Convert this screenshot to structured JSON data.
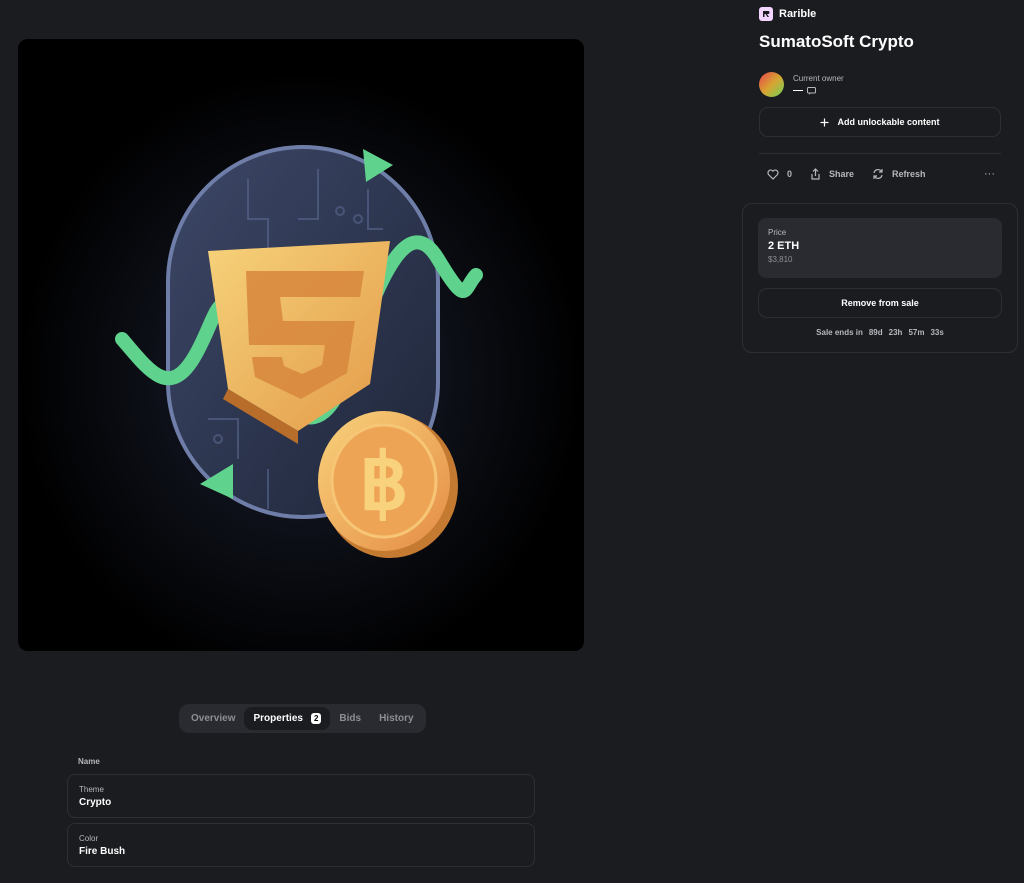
{
  "brand": {
    "name": "Rarible",
    "logo_icon": "rarible-logo-icon"
  },
  "item": {
    "title": "SumatoSoft Crypto"
  },
  "owner": {
    "label": "Current owner",
    "name": "—"
  },
  "unlockable": {
    "label": "Add unlockable content",
    "icon": "plus-icon"
  },
  "actions": {
    "likes": "0",
    "share_label": "Share",
    "refresh_label": "Refresh",
    "more_label": "···"
  },
  "sale": {
    "price_label": "Price",
    "price_value": "2 ETH",
    "price_fiat": "$3,810",
    "remove_label": "Remove from sale",
    "ends_label": "Sale ends in",
    "days": "89d",
    "hours": "23h",
    "minutes": "57m",
    "seconds": "33s"
  },
  "tabs": [
    {
      "label": "Overview"
    },
    {
      "label": "Properties",
      "count": "2"
    },
    {
      "label": "Bids"
    },
    {
      "label": "History"
    }
  ],
  "properties": {
    "header": "Name",
    "items": [
      {
        "key": "Theme",
        "value": "Crypto"
      },
      {
        "key": "Color",
        "value": "Fire Bush"
      }
    ]
  },
  "colors": {
    "background": "#1b1c20",
    "card_border": "#2e2f35",
    "panel": "#2a2b30",
    "accent_green": "#5fd38d",
    "accent_orange": "#f0a050"
  }
}
